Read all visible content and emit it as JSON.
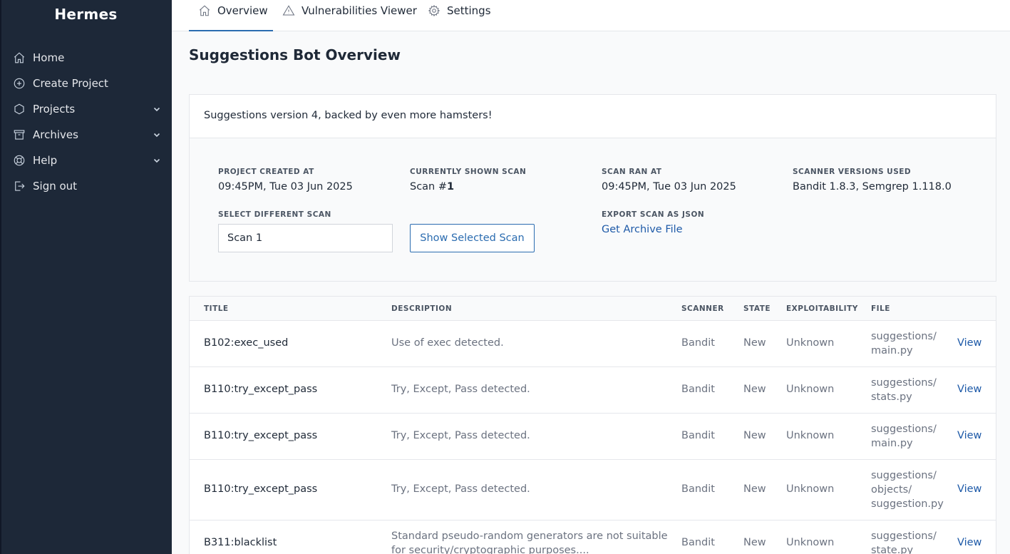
{
  "app": {
    "name": "Hermes"
  },
  "sidebar": {
    "items": [
      {
        "label": "Home",
        "icon": "home-icon"
      },
      {
        "label": "Create Project",
        "icon": "plus-circle-icon"
      },
      {
        "label": "Projects",
        "icon": "cube-icon",
        "expandable": true
      },
      {
        "label": "Archives",
        "icon": "archive-icon",
        "expandable": true
      },
      {
        "label": "Help",
        "icon": "lifebuoy-icon",
        "expandable": true
      },
      {
        "label": "Sign out",
        "icon": "sign-out-icon"
      }
    ]
  },
  "tabs": [
    {
      "label": "Overview",
      "icon": "home-icon",
      "active": true
    },
    {
      "label": "Vulnerabilities Viewer",
      "icon": "warning-icon",
      "active": false
    },
    {
      "label": "Settings",
      "icon": "gear-icon",
      "active": false
    }
  ],
  "page": {
    "title": "Suggestions Bot Overview"
  },
  "info": {
    "header": "Suggestions version 4, backed by even more hamsters!",
    "project_created_label": "Project Created At",
    "project_created_value": "09:45PM, Tue 03 Jun 2025",
    "current_scan_label": "Currently Shown Scan",
    "current_scan_prefix": "Scan #",
    "current_scan_number": "1",
    "scan_ran_label": "Scan Ran At",
    "scan_ran_value": "09:45PM, Tue 03 Jun 2025",
    "scanner_versions_label": "Scanner Versions Used",
    "scanner_versions_value": "Bandit 1.8.3, Semgrep 1.118.0",
    "select_scan_label": "Select Different Scan",
    "select_scan_value": "Scan 1",
    "show_button": "Show Selected Scan",
    "export_label": "Export Scan as JSON",
    "export_link": "Get Archive File"
  },
  "table": {
    "headers": {
      "title": "TITLE",
      "description": "DESCRIPTION",
      "scanner": "SCANNER",
      "state": "STATE",
      "exploitability": "EXPLOITABILITY",
      "file": "FILE"
    },
    "rows": [
      {
        "title": "B102:exec_used",
        "description": "Use of exec detected.",
        "scanner": "Bandit",
        "state": "New",
        "exploitability": "Unknown",
        "file": "suggestions/ main.py",
        "action": "View"
      },
      {
        "title": "B110:try_except_pass",
        "description": "Try, Except, Pass detected.",
        "scanner": "Bandit",
        "state": "New",
        "exploitability": "Unknown",
        "file": "suggestions/ stats.py",
        "action": "View"
      },
      {
        "title": "B110:try_except_pass",
        "description": "Try, Except, Pass detected.",
        "scanner": "Bandit",
        "state": "New",
        "exploitability": "Unknown",
        "file": "suggestions/ main.py",
        "action": "View"
      },
      {
        "title": "B110:try_except_pass",
        "description": "Try, Except, Pass detected.",
        "scanner": "Bandit",
        "state": "New",
        "exploitability": "Unknown",
        "file": "suggestions/ objects/ suggestion.py",
        "action": "View"
      },
      {
        "title": "B311:blacklist",
        "description": "Standard pseudo-random generators are not suitable for security/cryptographic purposes....",
        "scanner": "Bandit",
        "state": "New",
        "exploitability": "Unknown",
        "file": "suggestions/ state.py",
        "action": "View"
      }
    ]
  },
  "colors": {
    "sidebar_bg": "#1d2838",
    "accent": "#2b6cb0",
    "link": "#1e5aa8"
  }
}
